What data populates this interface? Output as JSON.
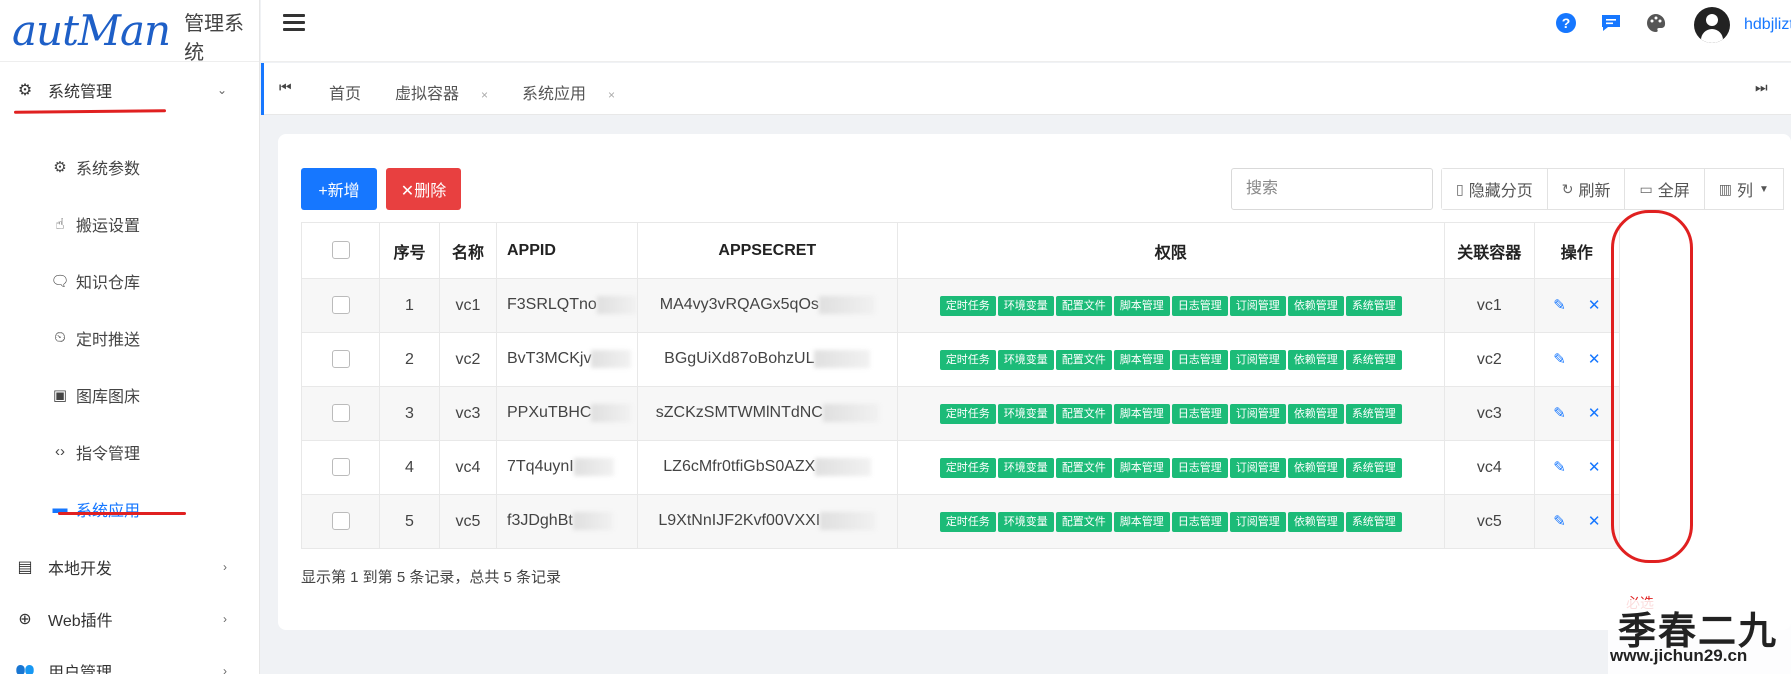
{
  "app": {
    "brand": "autMan",
    "subtitle": "管理系统"
  },
  "header": {
    "username": "hdbjlizt",
    "icons": [
      "help-icon",
      "message-icon",
      "palette-icon",
      "user-avatar"
    ]
  },
  "sidebar": {
    "groups": [
      {
        "label": "系统管理",
        "icon": "gear-icon",
        "expanded": true
      },
      {
        "label": "本地开发",
        "icon": "server-icon",
        "expanded": false
      },
      {
        "label": "Web插件",
        "icon": "globe-icon",
        "expanded": false
      },
      {
        "label": "用户管理",
        "icon": "users-icon",
        "expanded": false
      }
    ],
    "items": [
      {
        "label": "系统参数",
        "icon": "settings-icon"
      },
      {
        "label": "搬运设置",
        "icon": "hand-icon"
      },
      {
        "label": "知识仓库",
        "icon": "chat-help-icon"
      },
      {
        "label": "定时推送",
        "icon": "clock-icon"
      },
      {
        "label": "图库图床",
        "icon": "image-icon"
      },
      {
        "label": "指令管理",
        "icon": "code-icon"
      },
      {
        "label": "系统应用",
        "icon": "window-icon",
        "active": true
      }
    ]
  },
  "tabs": [
    {
      "label": "首页"
    },
    {
      "label": "虚拟容器",
      "closable": true
    },
    {
      "label": "系统应用",
      "closable": true
    }
  ],
  "toolbar": {
    "add_label": "+新增",
    "delete_label": "✕删除",
    "search_placeholder": "搜索",
    "hide_pagination": "隐藏分页",
    "refresh": "刷新",
    "fullscreen": "全屏",
    "columns": "列"
  },
  "table": {
    "headers": {
      "index": "序号",
      "name": "名称",
      "appid": "APPID",
      "appsecret": "APPSECRET",
      "permissions": "权限",
      "container": "关联容器",
      "actions": "操作"
    },
    "permission_tags": [
      "定时任务",
      "环境变量",
      "配置文件",
      "脚本管理",
      "日志管理",
      "订阅管理",
      "依赖管理",
      "系统管理"
    ],
    "rows": [
      {
        "index": "1",
        "name": "vc1",
        "appid": "F3SRLQTno",
        "appsecret": "MA4vy3vRQAGx5qOs",
        "container": "vc1"
      },
      {
        "index": "2",
        "name": "vc2",
        "appid": "BvT3MCKjv",
        "appsecret": "BGgUiXd87oBohzUL",
        "container": "vc2"
      },
      {
        "index": "3",
        "name": "vc3",
        "appid": "PPXuTBHC",
        "appsecret": "sZCKzSMTWMlNTdNC",
        "container": "vc3"
      },
      {
        "index": "4",
        "name": "vc4",
        "appid": "7Tq4uynI",
        "appsecret": "LZ6cMfr0tfiGbS0AZX",
        "container": "vc4"
      },
      {
        "index": "5",
        "name": "vc5",
        "appid": "f3JDghBt",
        "appsecret": "L9XtNnIJF2Kvf00VXXI",
        "container": "vc5"
      }
    ]
  },
  "pagination": {
    "summary": "显示第 1 到第 5 条记录，总共 5 条记录"
  },
  "annotation": {
    "note": "必选"
  },
  "watermark": {
    "title": "季春二九",
    "url": "www.jichun29.cn"
  },
  "colors": {
    "primary": "#1677ff",
    "danger": "#e84040",
    "tag": "#1cbb78",
    "annotation": "#e02020"
  }
}
